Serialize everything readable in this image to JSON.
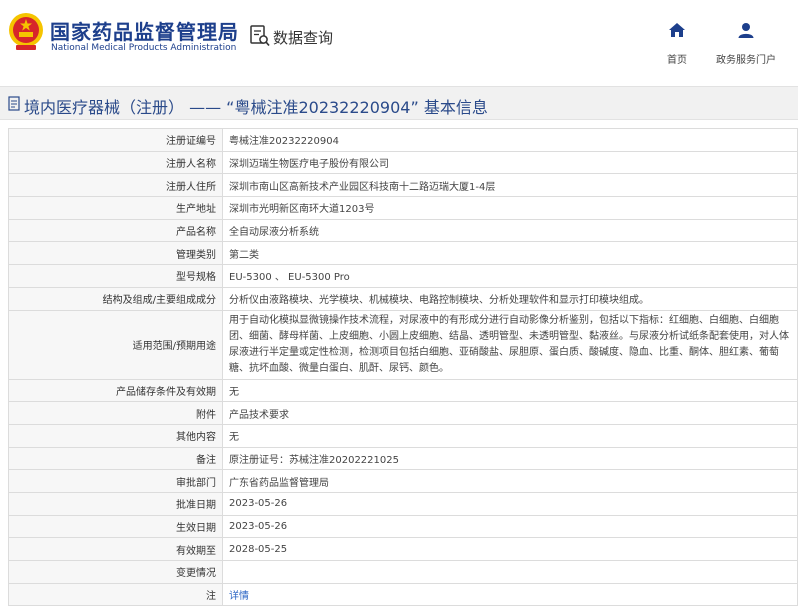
{
  "header": {
    "agency_cn": "国家药品监督管理局",
    "agency_en": "National Medical Products Administration",
    "query_label": "数据查询",
    "nav": [
      {
        "label": "首页",
        "icon": "home-icon"
      },
      {
        "label": "政务服务门户",
        "icon": "user-icon"
      }
    ]
  },
  "title": {
    "text": "境内医疗器械（注册） —— “粤械注准20232220904” 基本信息"
  },
  "fields": [
    {
      "key": "注册证编号",
      "value": "粤械注准20232220904"
    },
    {
      "key": "注册人名称",
      "value": "深圳迈瑞生物医疗电子股份有限公司"
    },
    {
      "key": "注册人住所",
      "value": "深圳市南山区高新技术产业园区科技南十二路迈瑞大厦1-4层"
    },
    {
      "key": "生产地址",
      "value": "深圳市光明新区南环大道1203号"
    },
    {
      "key": "产品名称",
      "value": "全自动尿液分析系统"
    },
    {
      "key": "管理类别",
      "value": "第二类"
    },
    {
      "key": "型号规格",
      "value": "EU-5300 、 EU-5300 Pro"
    },
    {
      "key": "结构及组成/主要组成成分",
      "value": "分析仪由液路模块、光学模块、机械模块、电路控制模块、分析处理软件和显示打印模块组成。"
    },
    {
      "key": "适用范围/预期用途",
      "value": "用于自动化模拟显微镜操作技术流程，对尿液中的有形成分进行自动影像分析鉴别，包括以下指标：红细胞、白细胞、白细胞团、细菌、酵母样菌、上皮细胞、小圆上皮细胞、结晶、透明管型、未透明管型、黏液丝。与尿液分析试纸条配套使用，对人体尿液进行半定量或定性检测，检测项目包括白细胞、亚硝酸盐、尿胆原、蛋白质、酸碱度、隐血、比重、酮体、胆红素、葡萄糖、抗坏血酸、微量白蛋白、肌酐、尿钙、颜色。"
    },
    {
      "key": "产品储存条件及有效期",
      "value": "无"
    },
    {
      "key": "附件",
      "value": "产品技术要求"
    },
    {
      "key": "其他内容",
      "value": "无"
    },
    {
      "key": "备注",
      "value": "原注册证号：苏械注准20202221025"
    },
    {
      "key": "审批部门",
      "value": "广东省药品监督管理局"
    },
    {
      "key": "批准日期",
      "value": "2023-05-26"
    },
    {
      "key": "生效日期",
      "value": "2023-05-26"
    },
    {
      "key": "有效期至",
      "value": "2028-05-25"
    },
    {
      "key": "变更情况",
      "value": ""
    },
    {
      "key": "注",
      "value": "详情"
    }
  ],
  "colors": {
    "brand_blue": "#1d3f8c",
    "title_blue": "#2a4a8a",
    "link_blue": "#2a64c4",
    "emblem_red": "#d7262a",
    "emblem_gold": "#f5c400"
  }
}
